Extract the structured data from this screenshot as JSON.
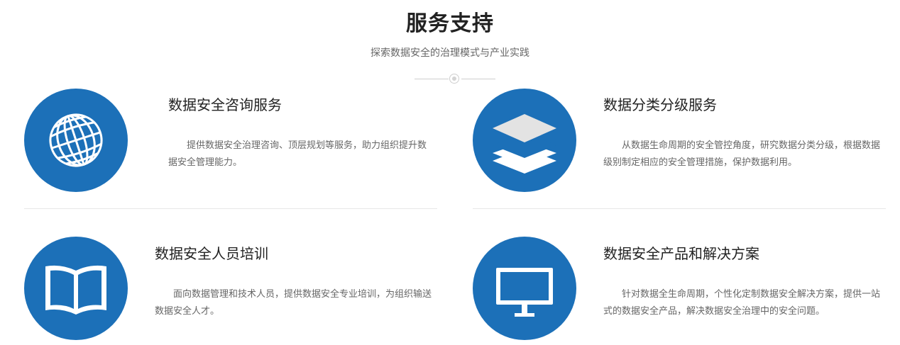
{
  "header": {
    "title": "服务支持",
    "subtitle": "探索数据安全的治理模式与产业实践"
  },
  "colors": {
    "accent": "#1c70b8",
    "title": "#222222",
    "text": "#666666"
  },
  "services": [
    {
      "title": "数据安全咨询服务",
      "desc": "提供数据安全治理咨询、顶层规划等服务，助力组织提升数据安全管理能力。",
      "icon": "globe-icon"
    },
    {
      "title": "数据分类分级服务",
      "desc": "从数据生命周期的安全管控角度，研究数据分类分级，根据数据级别制定相应的安全管理措施，保护数据利用。",
      "icon": "layers-icon"
    },
    {
      "title": "数据安全人员培训",
      "desc": "面向数据管理和技术人员，提供数据安全专业培训，为组织输送数据安全人才。",
      "icon": "book-icon"
    },
    {
      "title": "数据安全产品和解决方案",
      "desc": "针对数据全生命周期，个性化定制数据安全解决方案，提供一站式的数据安全产品，解决数据安全治理中的安全问题。",
      "icon": "monitor-icon"
    }
  ]
}
